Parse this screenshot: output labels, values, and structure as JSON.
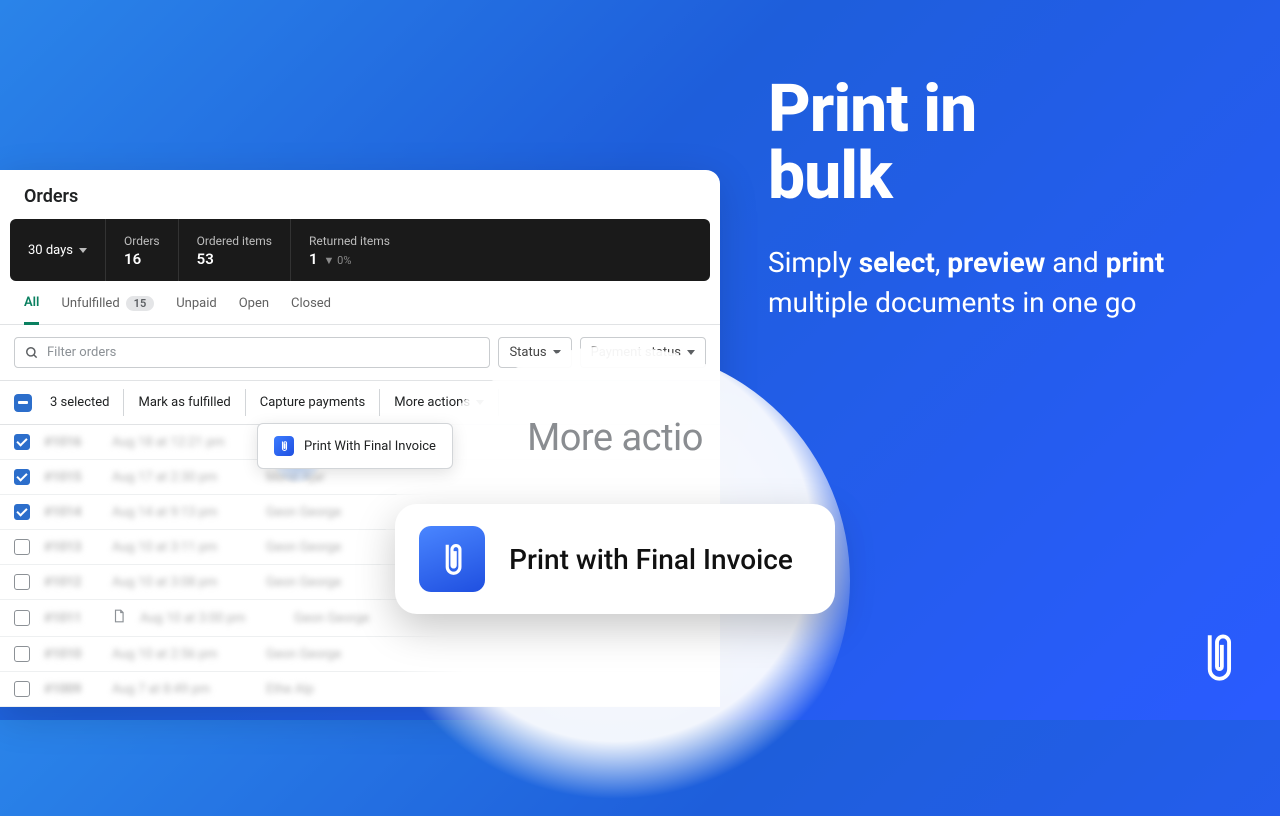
{
  "hero": {
    "title_line1": "Print in",
    "title_line2": "bulk",
    "sub_1": "Simply ",
    "sub_b1": "select",
    "sub_2": ", ",
    "sub_b2": "preview",
    "sub_3": " and ",
    "sub_b3": "print",
    "sub_4": " multiple documents in one go"
  },
  "window": {
    "title": "Orders"
  },
  "stats": {
    "range": "30 days",
    "orders_label": "Orders",
    "orders_value": "16",
    "items_label": "Ordered items",
    "items_value": "53",
    "returned_label": "Returned items",
    "returned_value": "1",
    "returned_pct": "0%"
  },
  "tabs": {
    "all": "All",
    "unfulfilled": "Unfulfilled",
    "unfulfilled_count": "15",
    "unpaid": "Unpaid",
    "open": "Open",
    "closed": "Closed"
  },
  "filters": {
    "search_placeholder": "Filter orders",
    "status": "Status",
    "payment": "Payment status"
  },
  "bulk": {
    "selected": "3 selected",
    "mark": "Mark as fulfilled",
    "capture": "Capture payments",
    "more": "More actions"
  },
  "dropdown": {
    "print": "Print With Final Invoice"
  },
  "rows": [
    {
      "checked": true,
      "id": "#1016",
      "date": "Aug 18 at 12:21 pm",
      "name": "—"
    },
    {
      "checked": true,
      "id": "#1015",
      "date": "Aug 17 at 2:30 pm",
      "name": "Meral Ajar"
    },
    {
      "checked": true,
      "id": "#1014",
      "date": "Aug 14 at 9:13 pm",
      "name": "Geon George"
    },
    {
      "checked": false,
      "id": "#1013",
      "date": "Aug 10 at 3:11 pm",
      "name": "Geon George"
    },
    {
      "checked": false,
      "id": "#1012",
      "date": "Aug 10 at 3:08 pm",
      "name": "Geon George"
    },
    {
      "checked": false,
      "id": "#1011",
      "date": "Aug 10 at 3:00 pm",
      "name": "Geon George",
      "doc": true
    },
    {
      "checked": false,
      "id": "#1010",
      "date": "Aug 10 at 2:56 pm",
      "name": "Geon George"
    },
    {
      "checked": false,
      "id": "#1009",
      "date": "Aug 7 at 8:49 pm",
      "name": "Ethe Alp"
    }
  ],
  "zoom": {
    "header": "More actio",
    "item": "Print with Final Invoice"
  }
}
